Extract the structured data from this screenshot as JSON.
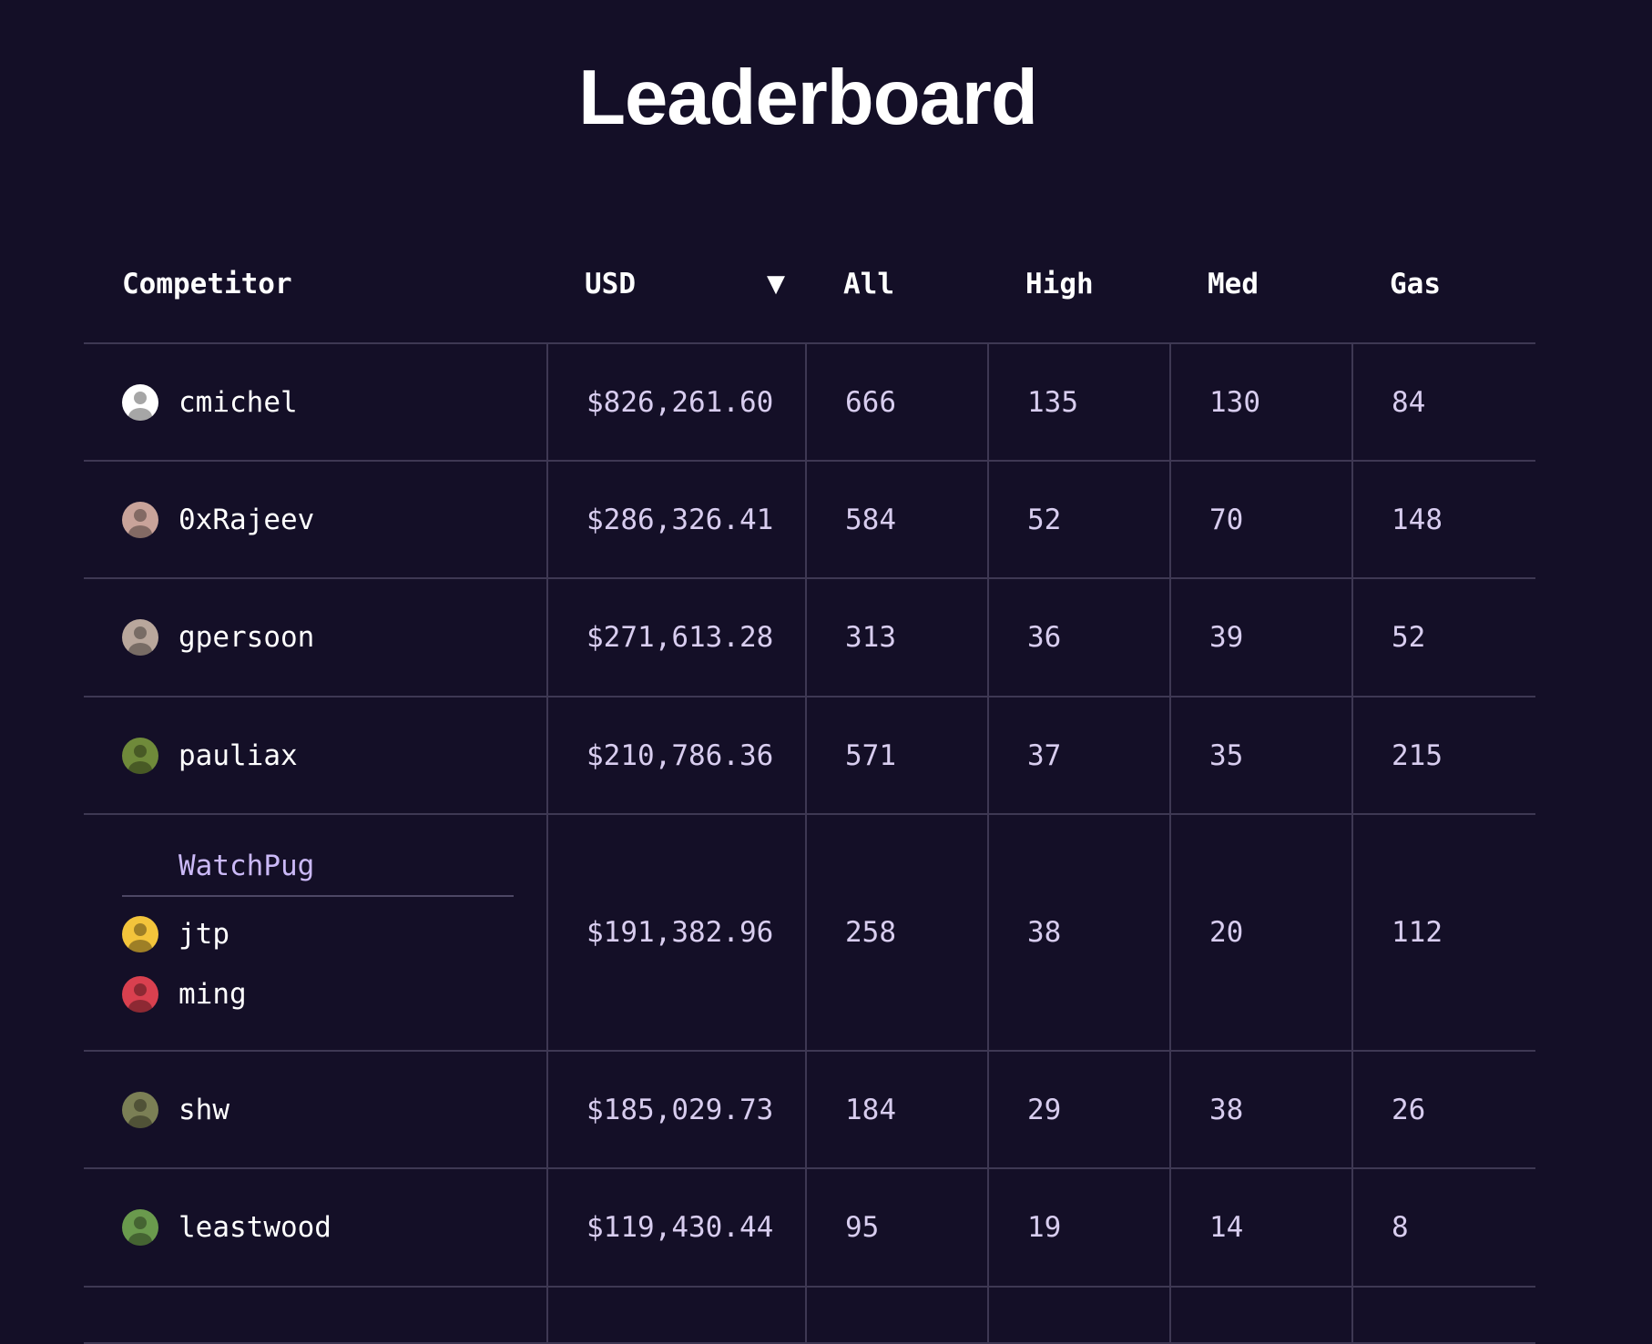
{
  "title": "Leaderboard",
  "columns": {
    "competitor": "Competitor",
    "usd": "USD",
    "sort_indicator": "▼",
    "all": "All",
    "high": "High",
    "med": "Med",
    "gas": "Gas"
  },
  "rows": [
    {
      "members": [
        {
          "name": "cmichel",
          "avatar_icon": "portrait-icon",
          "avatar_color": "#ffffff"
        }
      ],
      "usd": "$826,261.60",
      "all": "666",
      "high": "135",
      "med": "130",
      "gas": "84"
    },
    {
      "members": [
        {
          "name": "0xRajeev",
          "avatar_icon": "portrait-icon",
          "avatar_color": "#c9a39a"
        }
      ],
      "usd": "$286,326.41",
      "all": "584",
      "high": "52",
      "med": "70",
      "gas": "148"
    },
    {
      "members": [
        {
          "name": "gpersoon",
          "avatar_icon": "portrait-icon",
          "avatar_color": "#b9a79c"
        }
      ],
      "usd": "$271,613.28",
      "all": "313",
      "high": "36",
      "med": "39",
      "gas": "52"
    },
    {
      "members": [
        {
          "name": "pauliax",
          "avatar_icon": "flower-icon",
          "avatar_color": "#6f8a3a"
        }
      ],
      "usd": "$210,786.36",
      "all": "571",
      "high": "37",
      "med": "35",
      "gas": "215"
    },
    {
      "team": "WatchPug",
      "members": [
        {
          "name": "jtp",
          "avatar_icon": "dog-icon",
          "avatar_color": "#f3c43b"
        },
        {
          "name": "ming",
          "avatar_icon": "logo-icon",
          "avatar_color": "#d9404f"
        }
      ],
      "usd": "$191,382.96",
      "all": "258",
      "high": "38",
      "med": "20",
      "gas": "112"
    },
    {
      "members": [
        {
          "name": "shw",
          "avatar_icon": "landscape-icon",
          "avatar_color": "#7b7f55"
        }
      ],
      "usd": "$185,029.73",
      "all": "184",
      "high": "29",
      "med": "38",
      "gas": "26"
    },
    {
      "members": [
        {
          "name": "leastwood",
          "avatar_icon": "frog-icon",
          "avatar_color": "#6a9a4d"
        }
      ],
      "usd": "$119,430.44",
      "all": "95",
      "high": "19",
      "med": "14",
      "gas": "8"
    },
    {
      "members": [],
      "usd": "",
      "all": "",
      "high": "",
      "med": "",
      "gas": ""
    }
  ]
}
